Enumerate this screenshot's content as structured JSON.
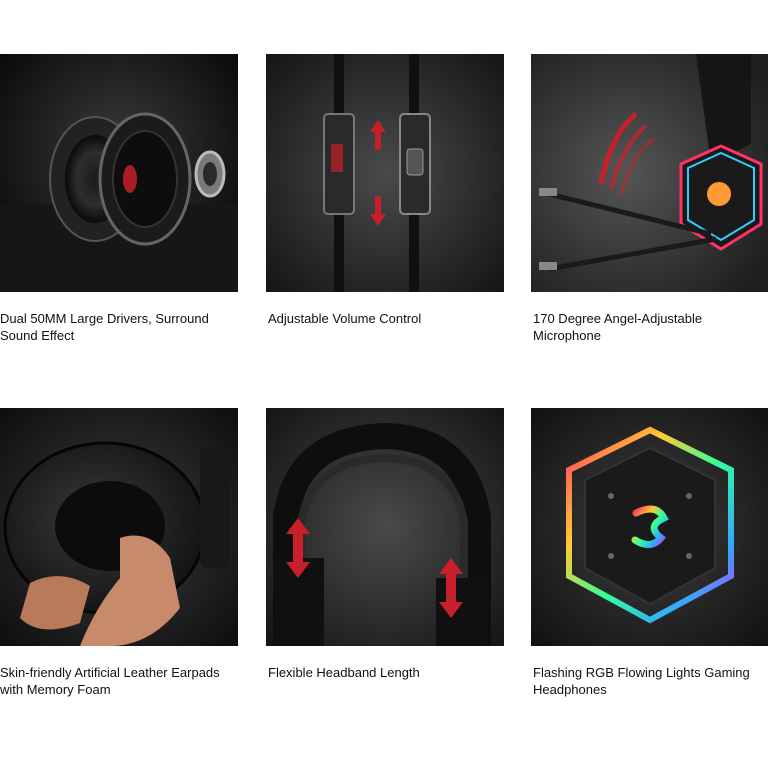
{
  "products": [
    {
      "caption": "Dual 50MM Large Drivers, Surround Sound Effect",
      "image": "driver-speaker-icon"
    },
    {
      "caption": "Adjustable Volume Control",
      "image": "volume-control-icon"
    },
    {
      "caption": "170 Degree Angel-Adjustable Microphone",
      "image": "microphone-icon"
    },
    {
      "caption": "Skin-friendly Artificial Leather Earpads with Memory Foam",
      "image": "earpad-icon"
    },
    {
      "caption": "Flexible Headband Length",
      "image": "headband-icon"
    },
    {
      "caption": "Flashing RGB Flowing Lights Gaming Headphones",
      "image": "rgb-light-icon"
    }
  ],
  "colors": {
    "accent_red": "#c8202a",
    "background": "#ffffff",
    "photo_dark": "#1a1a1a"
  }
}
